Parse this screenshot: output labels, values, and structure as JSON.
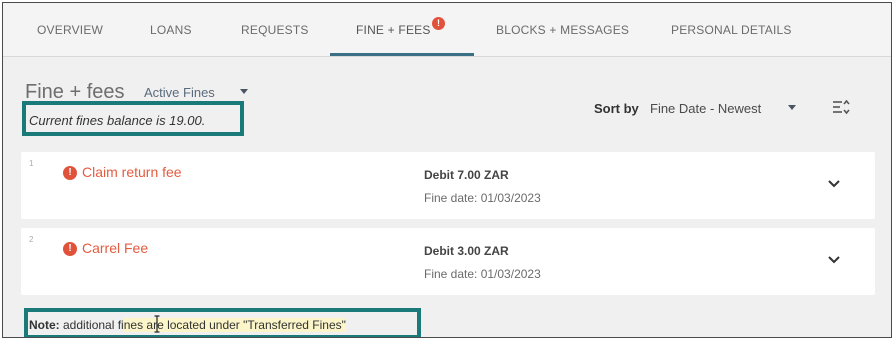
{
  "tabs": [
    {
      "label": "OVERVIEW"
    },
    {
      "label": "LOANS"
    },
    {
      "label": "REQUESTS"
    },
    {
      "label": "FINE + FEES",
      "badge": "!"
    },
    {
      "label": "BLOCKS + MESSAGES"
    },
    {
      "label": "PERSONAL DETAILS"
    }
  ],
  "active_tab": "FINE + FEES",
  "header": {
    "title": "Fine + fees",
    "filter_label": "Active Fines",
    "balance_text": "Current fines balance is 19.00.",
    "sort_label": "Sort by",
    "sort_value": "Fine Date - Newest"
  },
  "fines": [
    {
      "index": "1",
      "name": "Claim return fee",
      "debit": "Debit 7.00 ZAR",
      "date": "Fine date: 01/03/2023"
    },
    {
      "index": "2",
      "name": "Carrel Fee",
      "debit": "Debit 3.00 ZAR",
      "date": "Fine date: 01/03/2023"
    }
  ],
  "note": {
    "prefix": "Note:",
    "text_plain": " additional fi",
    "text_highlight": "nes are located under \"Transferred Fines\""
  },
  "colors": {
    "accent": "#3a6f86",
    "alert": "#e0533a",
    "fee_text": "#e45c3f",
    "annotation_box": "#1a7a7a",
    "highlight": "#fbf5c9"
  },
  "icons": {
    "alert": "exclamation-circle-icon",
    "sort": "sort-order-icon",
    "expand": "chevron-down-icon"
  }
}
